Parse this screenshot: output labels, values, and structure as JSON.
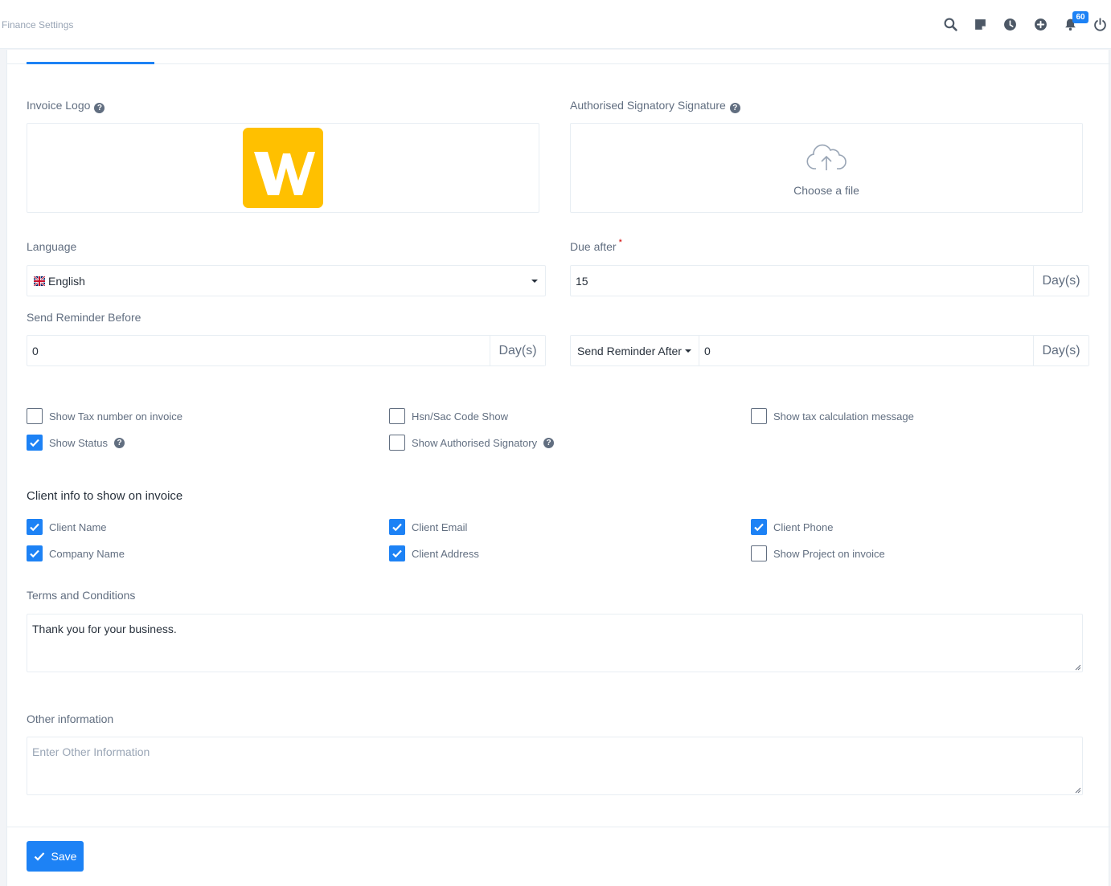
{
  "header": {
    "title": "Finance Settings",
    "notification_count": "60",
    "icons": [
      "search-icon",
      "sticky-note-icon",
      "clock-icon",
      "add-icon",
      "bell-icon",
      "power-icon"
    ]
  },
  "colors": {
    "accent": "#1d82f5",
    "logo_bg": "#ffc000"
  },
  "invoice_logo": {
    "label": "Invoice Logo",
    "help": "?"
  },
  "signature": {
    "label": "Authorised Signatory Signature",
    "help": "?",
    "choose_file": "Choose a file"
  },
  "language": {
    "label": "Language",
    "value": "English"
  },
  "due_after": {
    "label": "Due after",
    "required": "*",
    "value": "15",
    "unit": "Day(s)"
  },
  "reminder_before": {
    "label": "Send Reminder Before",
    "value": "0",
    "unit": "Day(s)"
  },
  "reminder_after": {
    "select": "Send Reminder After",
    "value": "0",
    "unit": "Day(s)"
  },
  "options": {
    "show_tax_number": {
      "label": "Show Tax number on invoice",
      "checked": false
    },
    "hsn_sac": {
      "label": "Hsn/Sac Code Show",
      "checked": false
    },
    "tax_calc_msg": {
      "label": "Show tax calculation message",
      "checked": false
    },
    "show_status": {
      "label": "Show Status",
      "checked": true,
      "help": "?"
    },
    "show_signatory": {
      "label": "Show Authorised Signatory",
      "checked": false,
      "help": "?"
    }
  },
  "client_info": {
    "title": "Client info to show on invoice",
    "client_name": {
      "label": "Client Name",
      "checked": true
    },
    "client_email": {
      "label": "Client Email",
      "checked": true
    },
    "client_phone": {
      "label": "Client Phone",
      "checked": true
    },
    "company_name": {
      "label": "Company Name",
      "checked": true
    },
    "client_address": {
      "label": "Client Address",
      "checked": true
    },
    "show_project": {
      "label": "Show Project on invoice",
      "checked": false
    }
  },
  "terms": {
    "label": "Terms and Conditions",
    "value": "Thank you for your business."
  },
  "other_info": {
    "label": "Other information",
    "placeholder": "Enter Other Information"
  },
  "save": {
    "label": "Save"
  }
}
